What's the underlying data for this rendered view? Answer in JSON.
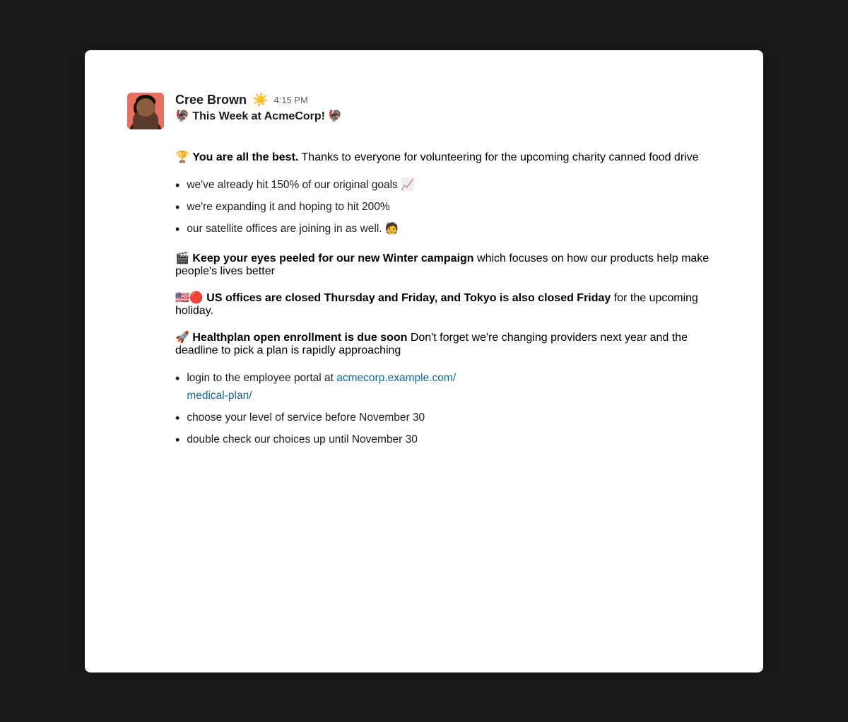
{
  "background": "#1a1a1a",
  "card": {
    "bg": "#ffffff"
  },
  "user": {
    "name": "Cree Brown",
    "timestamp": "4:15 PM",
    "sun_emoji": "☀️",
    "subject": "🦃 This Week at AcmeCorp! 🦃"
  },
  "content": {
    "section1": {
      "intro_emoji": "🏆",
      "bold": "You are all the best.",
      "text": " Thanks to everyone for volunteering for the upcoming charity canned food drive"
    },
    "bullets1": [
      "we've already hit 150% of our original goals 📈",
      "we're expanding it and hoping to hit 200%",
      "our satellite offices are joining in as well. 🧑‍💼"
    ],
    "section2": {
      "emoji": "🎬",
      "bold": "Keep your eyes peeled for our new Winter campaign",
      "text": " which focuses on how our products help make people's lives better"
    },
    "section3": {
      "emoji": "🇺🇸🔴",
      "bold": "US offices are closed Thursday and Friday, and Tokyo is also closed Friday",
      "text": " for the upcoming holiday."
    },
    "section4": {
      "emoji": "🚀",
      "bold": "Healthplan open enrollment is due soon",
      "text": " Don't forget we're changing providers next year and the deadline to pick a plan is rapidly approaching"
    },
    "bullets2": [
      {
        "text_prefix": "login to the employee portal at ",
        "link_text": "acmecorp.example.com/\nmedical-plan/",
        "link_href": "acmecorp.example.com/medical-plan/"
      }
    ],
    "bullets3": [
      "choose your level of service before November 30",
      "double check our choices up until November 30"
    ]
  },
  "labels": {
    "name": "Cree Brown",
    "timestamp": "4:15 PM",
    "subject": "🦃 This Week at AcmeCorp! 🦃",
    "link_text": "acmecorp.example.com/\nmedical-plan/"
  }
}
